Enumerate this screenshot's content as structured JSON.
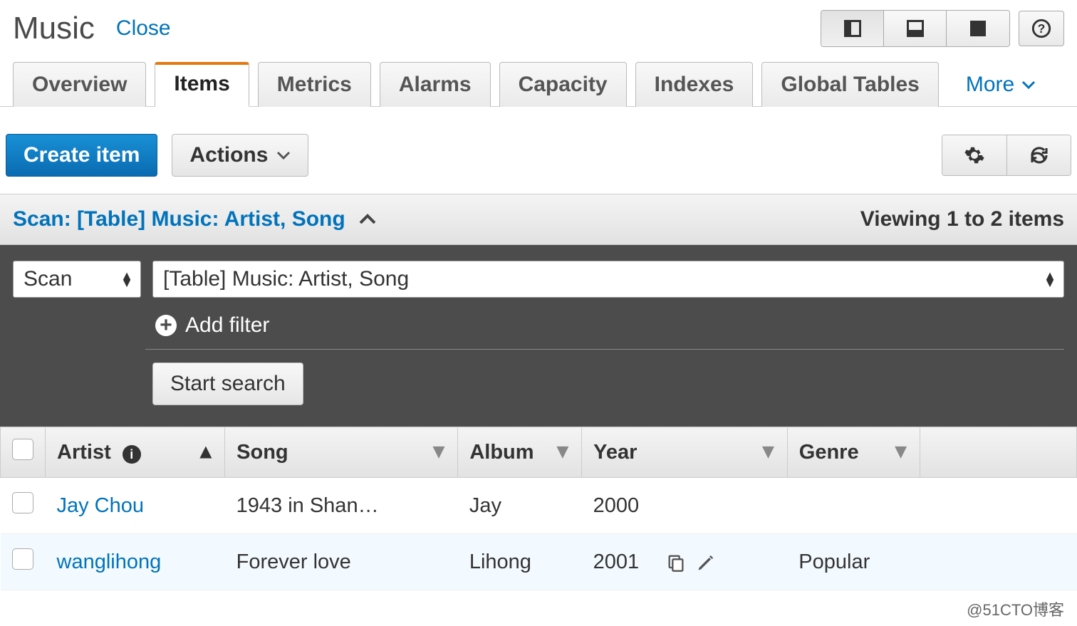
{
  "header": {
    "title": "Music",
    "close": "Close"
  },
  "tabs": {
    "items": [
      "Overview",
      "Items",
      "Metrics",
      "Alarms",
      "Capacity",
      "Indexes",
      "Global Tables"
    ],
    "more": "More",
    "active_index": 1
  },
  "toolbar": {
    "create": "Create item",
    "actions": "Actions"
  },
  "scan": {
    "summary": "Scan: [Table] Music: Artist, Song",
    "viewing": "Viewing 1 to 2 items",
    "mode": "Scan",
    "target": "[Table] Music: Artist, Song",
    "add_filter": "Add filter",
    "start_search": "Start search"
  },
  "table": {
    "columns": [
      "Artist",
      "Song",
      "Album",
      "Year",
      "Genre"
    ],
    "rows": [
      {
        "artist": "Jay Chou",
        "song": "1943 in Shan…",
        "album": "Jay",
        "year": "2000",
        "genre": ""
      },
      {
        "artist": "wanglihong",
        "song": "Forever love",
        "album": "Lihong",
        "year": "2001",
        "genre": "Popular"
      }
    ]
  },
  "footer": {
    "watermark": "@51CTO博客"
  }
}
